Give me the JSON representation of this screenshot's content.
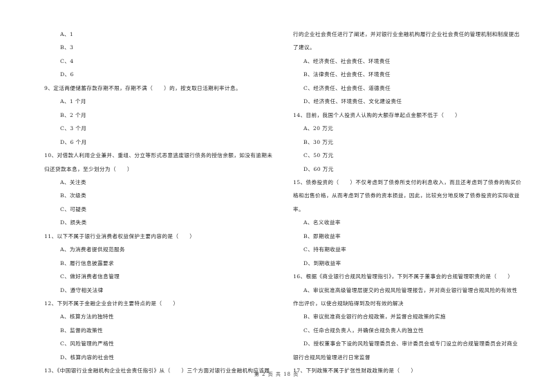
{
  "page": {
    "footer": "第 2 页 共 18 页"
  },
  "left_column": [
    {
      "kind": "option",
      "text": "A、1"
    },
    {
      "kind": "option",
      "text": "B、3"
    },
    {
      "kind": "option",
      "text": "C、4"
    },
    {
      "kind": "option",
      "text": "D、6"
    },
    {
      "kind": "question",
      "text": "9、定活两便储蓄存款存期不限，存期不满（　　）的，按支取日活期利率计息。"
    },
    {
      "kind": "option",
      "text": "A、1 个月"
    },
    {
      "kind": "option",
      "text": "B、2 个月"
    },
    {
      "kind": "option",
      "text": "C、3 个月"
    },
    {
      "kind": "option",
      "text": "D、6 个月"
    },
    {
      "kind": "question",
      "text": "10、对借款人利用企业兼并、重组、分立等形式恶意逃废银行债务的授信余额，如没有逾期未"
    },
    {
      "kind": "cont",
      "text": "归还贷款本息，至少划分为（　　）"
    },
    {
      "kind": "option",
      "text": "A、关注类"
    },
    {
      "kind": "option",
      "text": "B、次级类"
    },
    {
      "kind": "option",
      "text": "C、可疑类"
    },
    {
      "kind": "option",
      "text": "D、损失类"
    },
    {
      "kind": "question",
      "text": "11、以下不属于银行业消费者权益保护主要内容的是（　　）"
    },
    {
      "kind": "option",
      "text": "A、为消费者提供规范服务"
    },
    {
      "kind": "option",
      "text": "B、履行信息披露要求"
    },
    {
      "kind": "option",
      "text": "C、做好消费者信息管理"
    },
    {
      "kind": "option",
      "text": "D、遵守相关法律"
    },
    {
      "kind": "question",
      "text": "12、下列不属于金融企业会计的主要特点的是（　　）"
    },
    {
      "kind": "option",
      "text": "A、核算方法的独特性"
    },
    {
      "kind": "option",
      "text": "B、监督的政策性"
    },
    {
      "kind": "option",
      "text": "C、风险管理的严格性"
    },
    {
      "kind": "option",
      "text": "D、核算内容的社会性"
    },
    {
      "kind": "question",
      "text": "13、《中国银行业金融机构企业社会责任指引》从（　　）三个方面对银行业金融机构应该履"
    }
  ],
  "right_column": [
    {
      "kind": "cont",
      "text": "行的企业社会责任进行了阐述，并对银行业金融机构履行企业社会责任的管理机制和制度提出"
    },
    {
      "kind": "cont",
      "text": "了建议。"
    },
    {
      "kind": "option",
      "text": "A、经济责任、社会责任、环境责任"
    },
    {
      "kind": "option",
      "text": "B、法律责任、社会责任、环境责任"
    },
    {
      "kind": "option",
      "text": "C、经济责任、社会责任、道德责任"
    },
    {
      "kind": "option",
      "text": "D、经济责任、环境责任、文化建设责任"
    },
    {
      "kind": "question",
      "text": "14、目前，我国个人投资人认购的大额存单起点金额不低于（　　）"
    },
    {
      "kind": "option",
      "text": "A、20 万元"
    },
    {
      "kind": "option",
      "text": "B、30 万元"
    },
    {
      "kind": "option",
      "text": "C、50 万元"
    },
    {
      "kind": "option",
      "text": "D、60 万元"
    },
    {
      "kind": "question",
      "text": "15、债券投资的（　　）不仅考虑到了债券所支付的利息收入，而且还考虑到了债券的购买价"
    },
    {
      "kind": "cont",
      "text": "格和出售价格，从而考虑到了债券的资本损益，因此，比较充分地反映了债券投资的实际收益"
    },
    {
      "kind": "cont",
      "text": "率。"
    },
    {
      "kind": "option",
      "text": "A、名义收益率"
    },
    {
      "kind": "option",
      "text": "B、即期收益率"
    },
    {
      "kind": "option",
      "text": "C、持有期收益率"
    },
    {
      "kind": "option",
      "text": "D、到期收益率"
    },
    {
      "kind": "question",
      "text": "16、根据《商业银行合规风险管理指引》，下列不属于董事会的合规管理职责的是（　　）"
    },
    {
      "kind": "option",
      "text": "A、审议批准高级管理层提交的合规风险管理报告，并对商业银行管理合规风险的有效性"
    },
    {
      "kind": "cont",
      "text": "作出评价，以使合规缺陷得到及时有效的解决"
    },
    {
      "kind": "option",
      "text": "B、审议批准商业银行的合规政策，并监督合规政策的实施"
    },
    {
      "kind": "option",
      "text": "C、任命合规负责人，并确保合规负责人的独立性"
    },
    {
      "kind": "option",
      "text": "D、授权董事会下设的风险管理委员会、审计委员会或专门设立的合规管理委员会对商业"
    },
    {
      "kind": "cont",
      "text": "银行合规风险管理进行日常监督"
    },
    {
      "kind": "question",
      "text": "17、下列政策不属于扩张性财政政策的是（　　）"
    }
  ]
}
